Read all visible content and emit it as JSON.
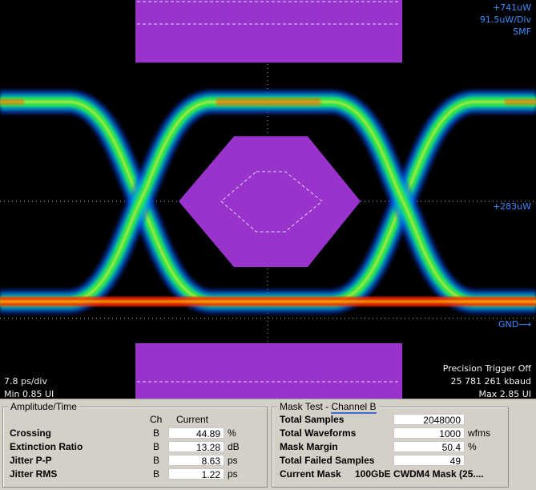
{
  "scope": {
    "top_right_readout": [
      "+741uW",
      "91.5uW/Div",
      "SMF"
    ],
    "mid_marker": "+283uW",
    "gnd_marker": "GND⟶",
    "timebase": "7.8 ps/div",
    "min_ui": "Min 0.85 UI",
    "trigger": "Precision Trigger Off",
    "rate": "25 781 261 kbaud",
    "max_ui": "Max 2.85 UI",
    "mask_color": "#9933cc"
  },
  "amplitude": {
    "title": "Amplitude/Time",
    "headers": {
      "ch": "Ch",
      "current": "Current"
    },
    "rows": [
      {
        "label": "Crossing",
        "ch": "B",
        "value": "44.89",
        "unit": "%"
      },
      {
        "label": "Extinction Ratio",
        "ch": "B",
        "value": "13.28",
        "unit": "dB"
      },
      {
        "label": "Jitter P-P",
        "ch": "B",
        "value": "8.63",
        "unit": "ps"
      },
      {
        "label": "Jitter RMS",
        "ch": "B",
        "value": "1.22",
        "unit": "ps"
      }
    ]
  },
  "mask": {
    "title_prefix": "Mask Test - ",
    "channel_link": "Channel B",
    "rows": [
      {
        "label": "Total Samples",
        "value": "2048000",
        "unit": ""
      },
      {
        "label": "Total Waveforms",
        "value": "1000",
        "unit": "wfms"
      },
      {
        "label": "Mask Margin",
        "value": "50.4",
        "unit": "%"
      },
      {
        "label": "Total Failed Samples",
        "value": "49",
        "unit": ""
      }
    ],
    "current_mask_label": "Current Mask",
    "current_mask_value": "100GbE  CWDM4  Mask (25...."
  }
}
